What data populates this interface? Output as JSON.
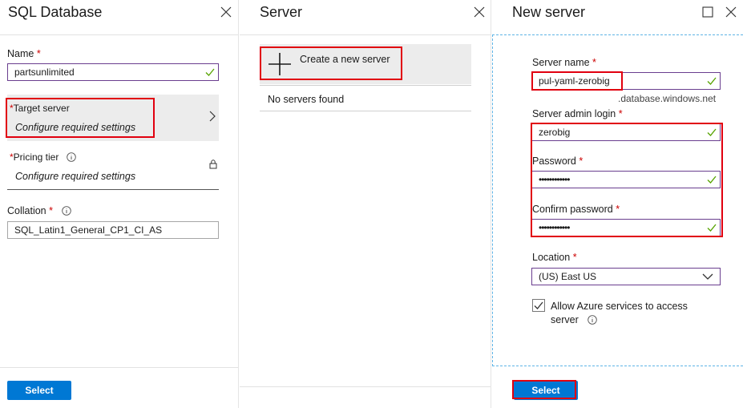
{
  "sql_blade": {
    "title": "SQL Database",
    "name_label": "Name",
    "name_value": "partsunlimited",
    "target_server_label": "Target server",
    "target_server_hint": "Configure required settings",
    "pricing_tier_label": "Pricing tier",
    "pricing_tier_hint": "Configure required settings",
    "collation_label": "Collation",
    "collation_value": "SQL_Latin1_General_CP1_CI_AS",
    "select_label": "Select",
    "required_mark": "*"
  },
  "server_blade": {
    "title": "Server",
    "create_label": "Create a new server",
    "empty_text": "No servers found"
  },
  "new_server_blade": {
    "title": "New server",
    "server_name_label": "Server name",
    "server_name_value": "pul-yaml-zerobig",
    "server_name_suffix": ".database.windows.net",
    "admin_login_label": "Server admin login",
    "admin_login_value": "zerobig",
    "password_label": "Password",
    "password_value": "••••••••••••",
    "confirm_password_label": "Confirm password",
    "confirm_password_value": "••••••••••••",
    "location_label": "Location",
    "location_value": "(US) East US",
    "allow_azure_label_line1": "Allow Azure services to access",
    "allow_azure_label_line2": "server",
    "allow_azure_checked": true,
    "select_label": "Select",
    "required_mark": "*"
  },
  "colors": {
    "accent": "#0078d4",
    "highlight_box": "#e1000f",
    "input_border_active": "#6a3e8f",
    "valid_check": "#57a300",
    "dashed_focus": "#5eb4e6"
  }
}
